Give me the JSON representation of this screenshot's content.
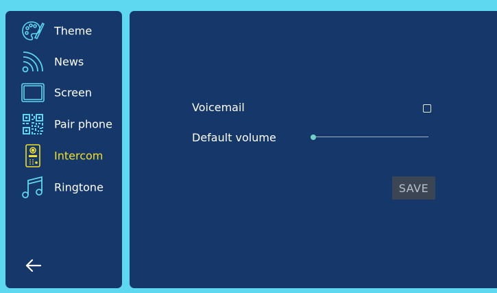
{
  "sidebar": {
    "items": [
      {
        "label": "Theme",
        "icon": "palette-icon"
      },
      {
        "label": "News",
        "icon": "rss-icon"
      },
      {
        "label": "Screen",
        "icon": "screen-icon"
      },
      {
        "label": "Pair phone",
        "icon": "qr-code-icon"
      },
      {
        "label": "Intercom",
        "icon": "intercom-icon",
        "active": true
      },
      {
        "label": "Ringtone",
        "icon": "music-note-icon"
      }
    ],
    "back_icon": "arrow-left-icon"
  },
  "settings": {
    "voicemail_label": "Voicemail",
    "voicemail_checked": false,
    "default_volume_label": "Default volume",
    "default_volume_value": 0,
    "save_label": "SAVE"
  },
  "colors": {
    "background": "#5ed8f0",
    "panel": "#16376a",
    "active_text": "#f2e12a",
    "icon_accent": "#5ed8f0",
    "slider_accent": "#6fd0c6",
    "save_button": "#3c4554"
  }
}
